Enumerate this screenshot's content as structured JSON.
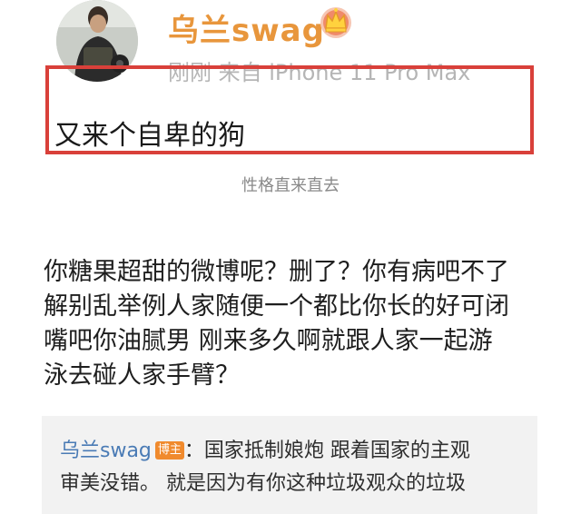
{
  "post": {
    "username": "乌兰swag",
    "meta": "刚刚  来自 iPhone 11 Pro Max",
    "text": "又来个自卑的狗",
    "caption": "性格直来直去"
  },
  "reply": {
    "lines": [
      "你糖果超甜的微博呢？删了？你有病吧不了",
      "解别乱举例人家随便一个都比你长的好可闭",
      "嘴吧你油腻男 刚来多久啊就跟人家一起游",
      "泳去碰人家手臂？"
    ]
  },
  "quote": {
    "username": "乌兰swag",
    "badge": "博主",
    "line1": "：国家抵制娘炮  跟着国家的主观",
    "line2": "审美没错。 就是因为有你这种垃圾观众的垃圾"
  },
  "colors": {
    "username": "#e8963c",
    "highlight_border": "#d9403a",
    "quote_user": "#4a7bb5",
    "badge_bg": "#f08a2d"
  },
  "icons": {
    "crown": "crown-icon"
  }
}
